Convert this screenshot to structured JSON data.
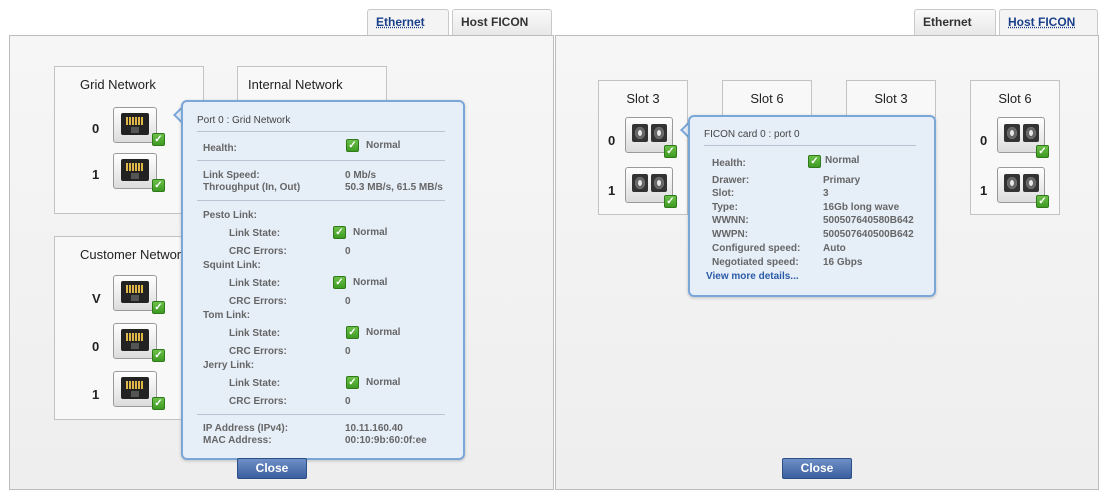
{
  "left": {
    "tabs": [
      {
        "label": "Ethernet",
        "active": true
      },
      {
        "label": "Host FICON",
        "active": false
      }
    ],
    "cards": {
      "grid": {
        "title": "Grid Network",
        "ports": [
          "0",
          "1"
        ]
      },
      "internal": {
        "title": "Internal Network"
      },
      "customer": {
        "title": "Customer Network",
        "ports": [
          "V",
          "0",
          "1"
        ]
      }
    },
    "popup": {
      "title": "Port 0 : Grid Network",
      "health_label": "Health:",
      "health_value": "Normal",
      "link_speed_label": "Link Speed:",
      "link_speed_value": "0 Mb/s",
      "throughput_label": "Throughput (In, Out)",
      "throughput_value": "50.3 MB/s, 61.5 MB/s",
      "links": [
        {
          "name": "Pesto Link:",
          "state_label": "Link State:",
          "state_value": "Normal",
          "crc_label": "CRC Errors:",
          "crc_value": "0"
        },
        {
          "name": "Squint Link:",
          "state_label": "Link State:",
          "state_value": "Normal",
          "crc_label": "CRC Errors:",
          "crc_value": "0"
        },
        {
          "name": "Tom Link:",
          "state_label": "Link State:",
          "state_value": "Normal",
          "crc_label": "CRC Errors:",
          "crc_value": "0"
        },
        {
          "name": "Jerry Link:",
          "state_label": "Link State:",
          "state_value": "Normal",
          "crc_label": "CRC Errors:",
          "crc_value": "0"
        }
      ],
      "ip_label": "IP Address (IPv4):",
      "ip_value": "10.11.160.40",
      "mac_label": "MAC Address:",
      "mac_value": "00:10:9b:60:0f:ee"
    },
    "close_label": "Close"
  },
  "right": {
    "tabs": [
      {
        "label": "Ethernet",
        "active": false
      },
      {
        "label": "Host FICON",
        "active": true
      }
    ],
    "cards": [
      {
        "title": "Slot 3",
        "ports": [
          "0",
          "1"
        ]
      },
      {
        "title": "Slot 6"
      },
      {
        "title": "Slot 3"
      },
      {
        "title": "Slot 6",
        "ports": [
          "0",
          "1"
        ]
      }
    ],
    "popup": {
      "title": "FICON card 0 : port 0",
      "health_label": "Health:",
      "health_value": "Normal",
      "rows": [
        {
          "label": "Drawer:",
          "value": "Primary"
        },
        {
          "label": "Slot:",
          "value": "3"
        },
        {
          "label": "Type:",
          "value": "16Gb long wave"
        },
        {
          "label": "WWNN:",
          "value": "500507640580B642"
        },
        {
          "label": "WWPN:",
          "value": "500507640500B642"
        },
        {
          "label": "Configured speed:",
          "value": "Auto"
        },
        {
          "label": "Negotiated speed:",
          "value": "16 Gbps"
        }
      ],
      "more_link": "View more details..."
    },
    "close_label": "Close"
  },
  "icons": {
    "status": "check-icon",
    "ethernet": "ethernet-port-icon",
    "fiber": "fiber-port-icon"
  },
  "colors": {
    "accent": "#3b5e9e",
    "popup_border": "#7aa6d8",
    "check": "#4aa82e"
  }
}
